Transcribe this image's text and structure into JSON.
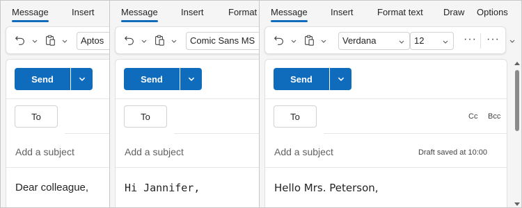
{
  "panes": [
    {
      "tabs": [
        "Message",
        "Insert"
      ],
      "font_name": "Aptos",
      "send_label": "Send",
      "to_label": "To",
      "subject_placeholder": "Add a subject",
      "body_text": "Dear colleague,"
    },
    {
      "tabs": [
        "Message",
        "Insert",
        "Format"
      ],
      "font_name": "Comic Sans MS",
      "send_label": "Send",
      "to_label": "To",
      "subject_placeholder": "Add a subject",
      "body_text": "Hi Jannifer,"
    },
    {
      "tabs": [
        "Message",
        "Insert",
        "Format text",
        "Draw",
        "Options"
      ],
      "font_name": "Verdana",
      "font_size": "12",
      "more_label": "···",
      "send_label": "Send",
      "to_label": "To",
      "cc_label": "Cc",
      "bcc_label": "Bcc",
      "subject_placeholder": "Add a subject",
      "draft_status": "Draft saved at 10:00",
      "body_text": "Hello Mrs. Peterson,"
    }
  ],
  "icons": {
    "undo": "undo-icon",
    "paste": "clipboard-icon",
    "chevron": "chevron-down-icon"
  },
  "colors": {
    "accent": "#0f6cbd",
    "button_text": "#ffffff"
  }
}
